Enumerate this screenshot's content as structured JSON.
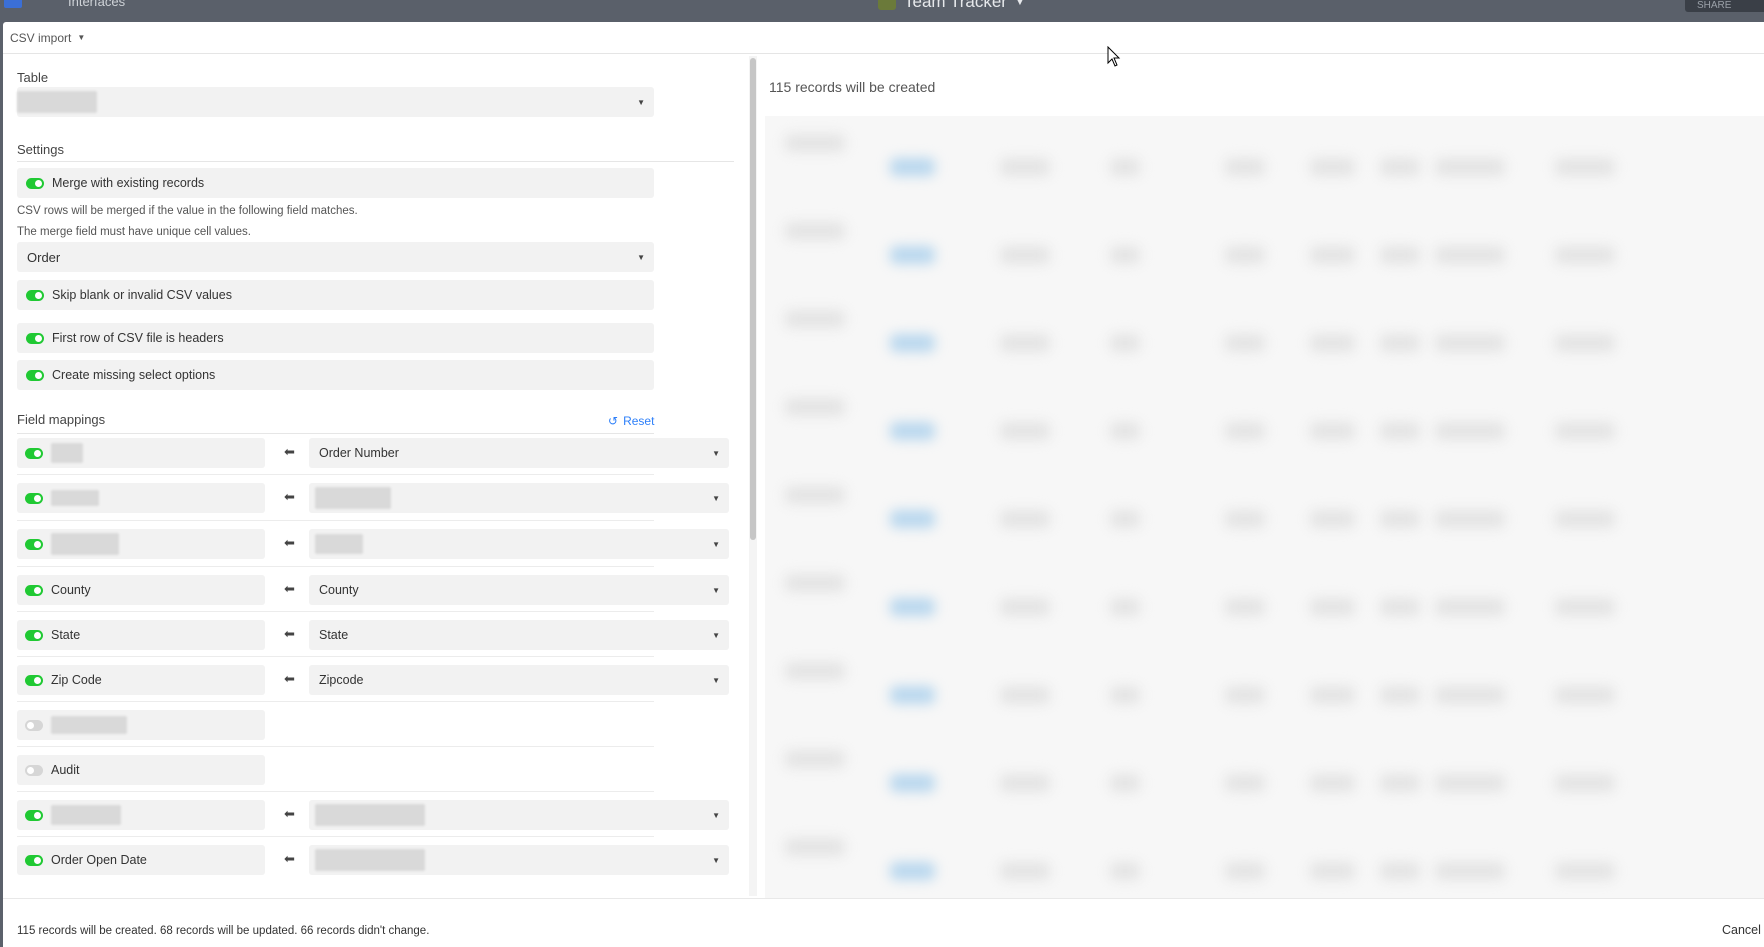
{
  "topbar": {
    "section_label": "Interfaces",
    "base_title": "Team Tracker",
    "share_label": "SHARE"
  },
  "modal": {
    "header_label": "CSV import"
  },
  "table_section": {
    "label": "Table"
  },
  "settings": {
    "label": "Settings",
    "merge_label": "Merge with existing records",
    "merge_help_1": "CSV rows will be merged if the value in the following field matches.",
    "merge_help_2": "The merge field must have unique cell values.",
    "merge_field": "Order",
    "skip_blank_label": "Skip blank or invalid CSV values",
    "first_row_headers_label": "First row of CSV file is headers",
    "create_options_label": "Create missing select options"
  },
  "field_mappings": {
    "label": "Field mappings",
    "reset_label": "Reset",
    "rows": [
      {
        "source": "",
        "target": "Order Number",
        "enabled": true
      },
      {
        "source": "",
        "target": "",
        "enabled": true
      },
      {
        "source": "",
        "target": "",
        "enabled": true
      },
      {
        "source": "County",
        "target": "County",
        "enabled": true
      },
      {
        "source": "State",
        "target": "State",
        "enabled": true
      },
      {
        "source": "Zip Code",
        "target": "Zipcode",
        "enabled": true
      },
      {
        "source": "",
        "target": null,
        "enabled": false
      },
      {
        "source": "Audit",
        "target": null,
        "enabled": false
      },
      {
        "source": "",
        "target": "",
        "enabled": true
      },
      {
        "source": "Order Open Date",
        "target": "",
        "enabled": true
      }
    ]
  },
  "preview": {
    "title": "115 records will be created"
  },
  "footer": {
    "summary": "115 records will be created. 68 records will be updated. 66 records didn't change.",
    "cancel_label": "Cancel"
  },
  "colors": {
    "toggle_on": "#20c933",
    "link_blue": "#2d7ff9",
    "field_bg": "#f2f2f2"
  }
}
